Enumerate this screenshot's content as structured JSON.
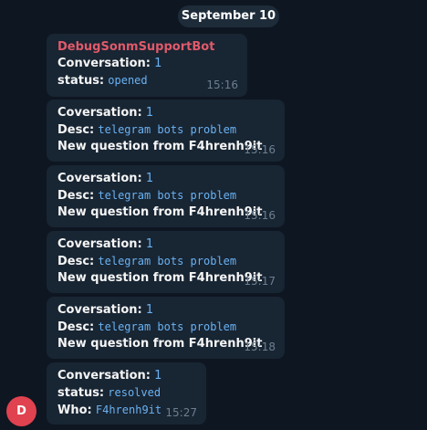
{
  "date_label": "September 10",
  "avatar_initial": "D",
  "messages": [
    {
      "sender": "DebugSonmSupportBot",
      "l1_label": "Conversation:",
      "l1_value": "1",
      "l2_label": "status:",
      "l2_value": "opened",
      "time": "15:16"
    },
    {
      "l1_label": "Coversation:",
      "l1_value": "1",
      "l2_label": "Desc:",
      "l2_value": "telegram bots problem",
      "l3_text": "New question from F4hrenh9it",
      "time": "15:16"
    },
    {
      "l1_label": "Coversation:",
      "l1_value": "1",
      "l2_label": "Desc:",
      "l2_value": "telegram bots problem",
      "l3_text": "New question from F4hrenh9it",
      "time": "15:16"
    },
    {
      "l1_label": "Coversation:",
      "l1_value": "1",
      "l2_label": "Desc:",
      "l2_value": "telegram bots problem",
      "l3_text": "New question from F4hrenh9it",
      "time": "15:17"
    },
    {
      "l1_label": "Coversation:",
      "l1_value": "1",
      "l2_label": "Desc:",
      "l2_value": "telegram bots problem",
      "l3_text": "New question from F4hrenh9it",
      "time": "15:18"
    },
    {
      "l1_label": "Conversation:",
      "l1_value": "1",
      "l2_label": "status:",
      "l2_value": "resolved",
      "l3_label": "Who:",
      "l3_value": "F4hrenh9it",
      "time": "15:27"
    }
  ],
  "colors": {
    "background": "#0e1621",
    "bubble": "#182533",
    "sender": "#e05a6a",
    "link": "#6ab2f2",
    "avatar": "#e0424f"
  }
}
